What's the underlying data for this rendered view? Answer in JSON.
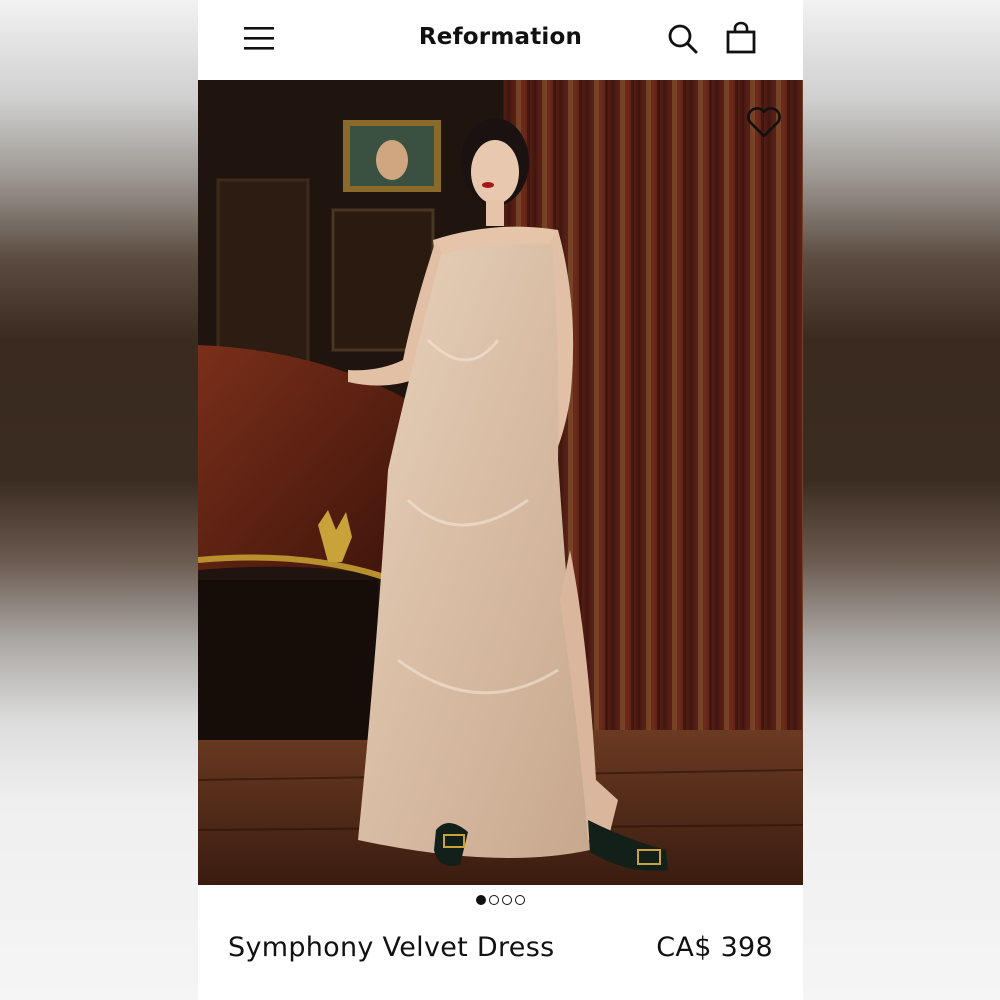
{
  "header": {
    "brand": "Reformation",
    "menu_icon": "hamburger-menu-icon",
    "search_icon": "search-icon",
    "bag_icon": "shopping-bag-icon"
  },
  "product": {
    "image_alt": "Model wearing a champagne velvet slip maxi dress in an ornate room",
    "favorite_icon": "heart-icon",
    "carousel": {
      "total": 4,
      "active": 1
    },
    "name": "Symphony Velvet Dress",
    "price": "CA$ 398"
  },
  "colors": {
    "text": "#111111",
    "background": "#ffffff"
  }
}
